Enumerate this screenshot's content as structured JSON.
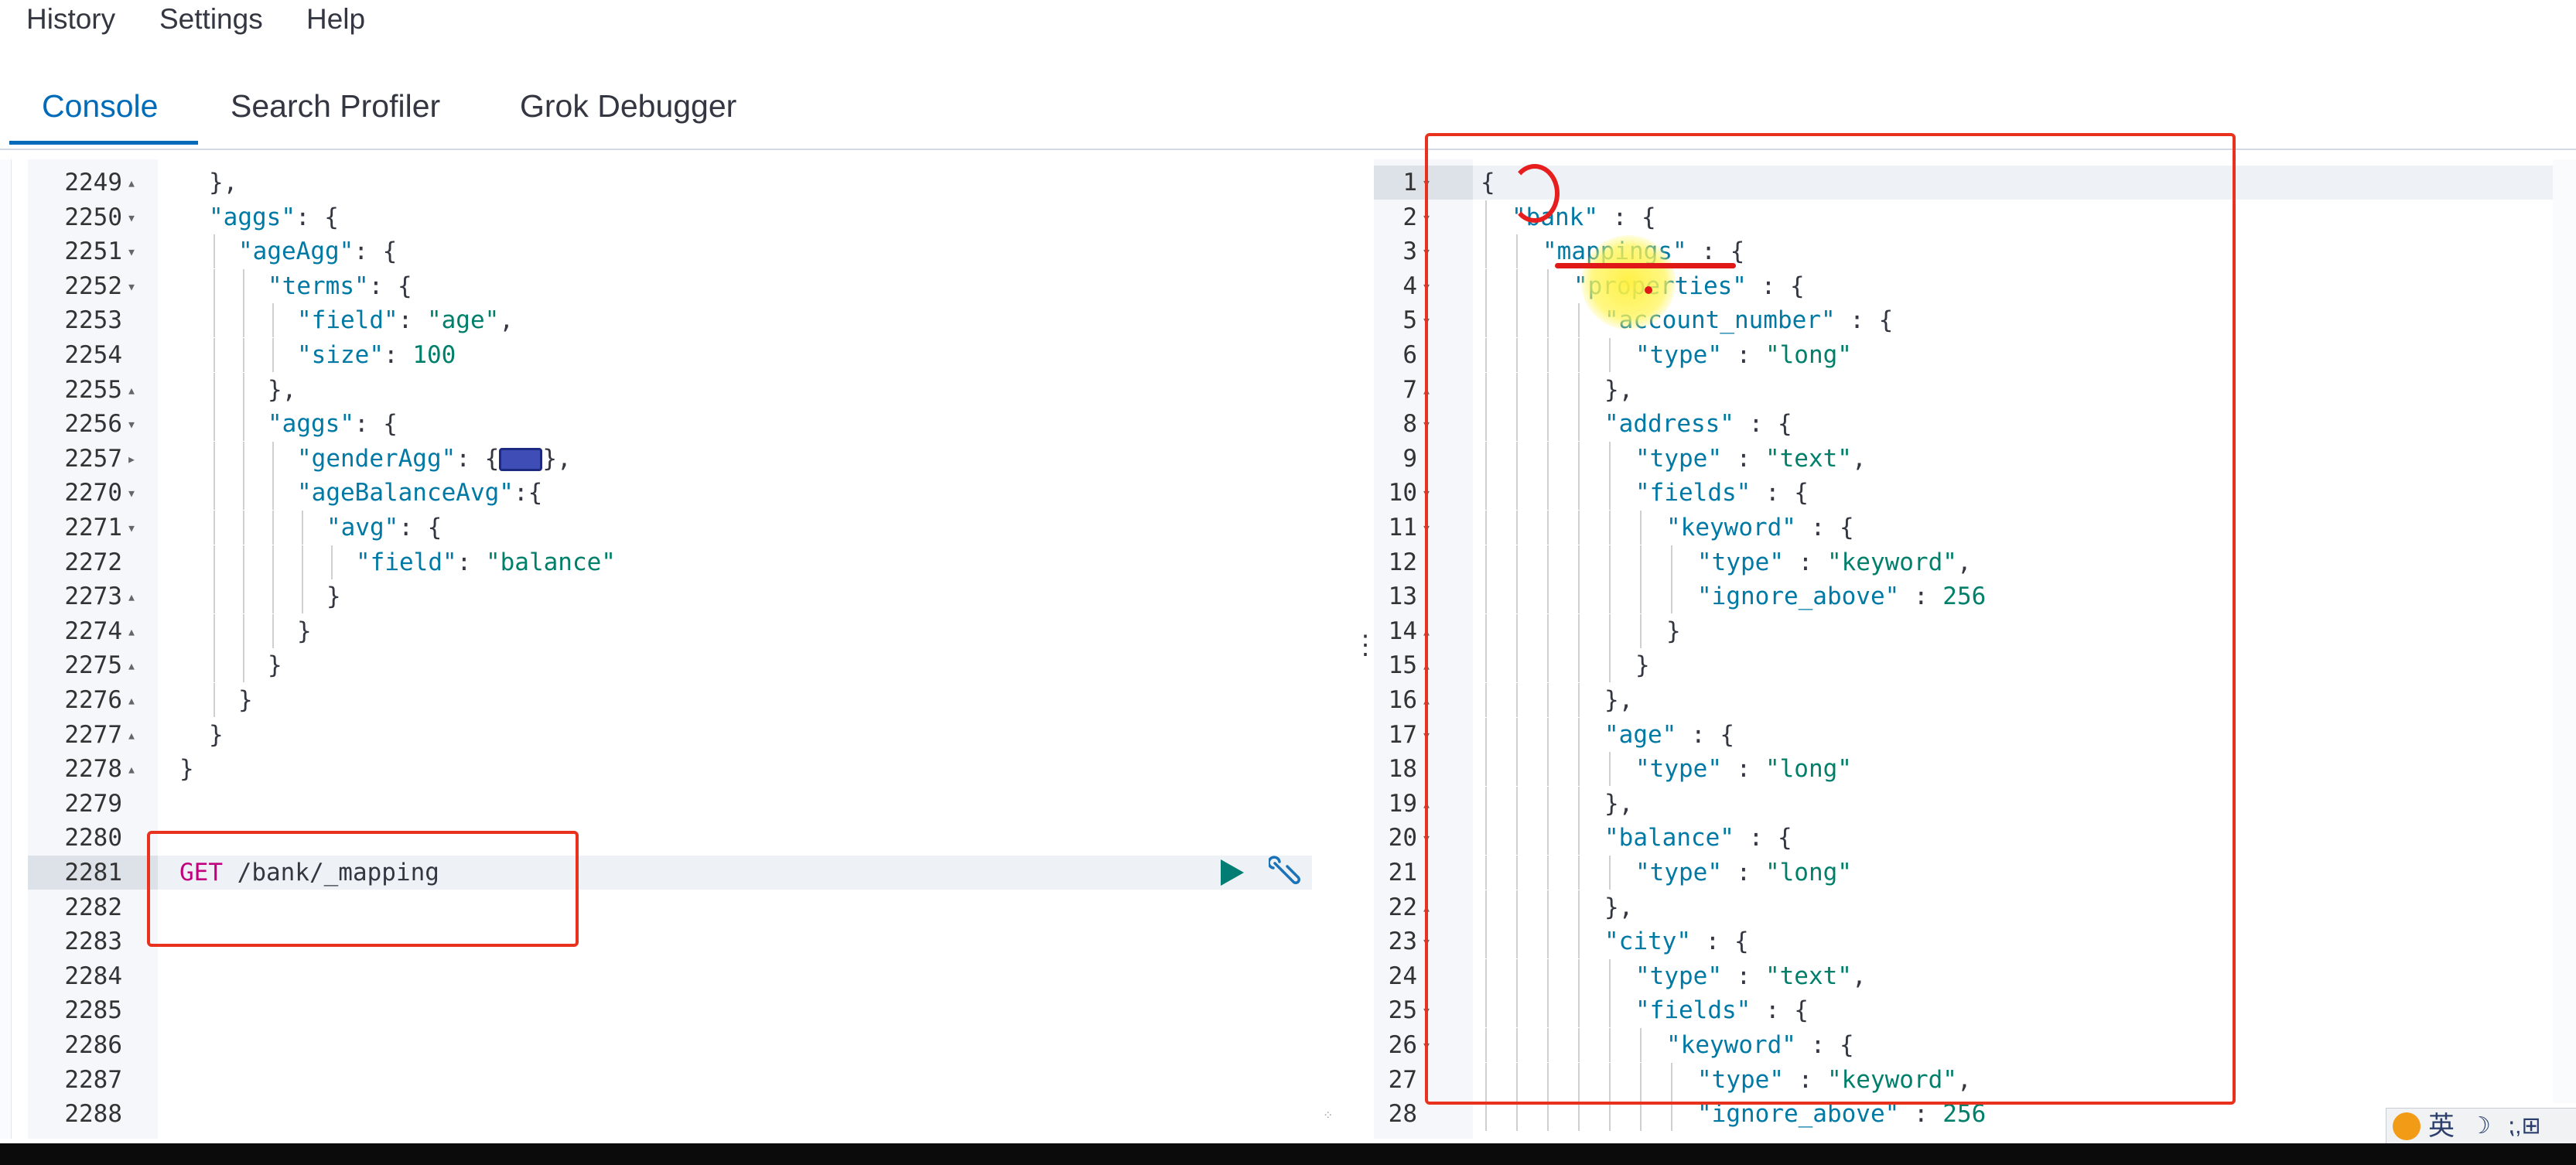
{
  "menu": {
    "history": "History",
    "settings": "Settings",
    "help": "Help"
  },
  "tabs": [
    {
      "label": "Console",
      "active": true
    },
    {
      "label": "Search Profiler",
      "active": false
    },
    {
      "label": "Grok Debugger",
      "active": false
    }
  ],
  "request_editor": {
    "active_line": "2281",
    "lines": [
      {
        "num": "2249",
        "fold": "▴",
        "indent": 1,
        "tokens": [
          [
            "p",
            "},"
          ]
        ]
      },
      {
        "num": "2250",
        "fold": "▾",
        "indent": 1,
        "tokens": [
          [
            "k",
            "\"aggs\""
          ],
          [
            "p",
            ": {"
          ]
        ]
      },
      {
        "num": "2251",
        "fold": "▾",
        "indent": 2,
        "tokens": [
          [
            "k",
            "\"ageAgg\""
          ],
          [
            "p",
            ": {"
          ]
        ]
      },
      {
        "num": "2252",
        "fold": "▾",
        "indent": 3,
        "tokens": [
          [
            "k",
            "\"terms\""
          ],
          [
            "p",
            ": {"
          ]
        ]
      },
      {
        "num": "2253",
        "fold": "",
        "indent": 4,
        "tokens": [
          [
            "k",
            "\"field\""
          ],
          [
            "p",
            ": "
          ],
          [
            "s",
            "\"age\""
          ],
          [
            "p",
            ","
          ]
        ]
      },
      {
        "num": "2254",
        "fold": "",
        "indent": 4,
        "tokens": [
          [
            "k",
            "\"size\""
          ],
          [
            "p",
            ": "
          ],
          [
            "n",
            "100"
          ]
        ]
      },
      {
        "num": "2255",
        "fold": "▴",
        "indent": 3,
        "tokens": [
          [
            "p",
            "},"
          ]
        ]
      },
      {
        "num": "2256",
        "fold": "▾",
        "indent": 3,
        "tokens": [
          [
            "k",
            "\"aggs\""
          ],
          [
            "p",
            ": {"
          ]
        ]
      },
      {
        "num": "2257",
        "fold": "▸",
        "indent": 4,
        "tokens": [
          [
            "k",
            "\"genderAgg\""
          ],
          [
            "p",
            ": {"
          ],
          [
            "c",
            "⟺"
          ],
          [
            "p",
            "},"
          ]
        ]
      },
      {
        "num": "2270",
        "fold": "▾",
        "indent": 4,
        "tokens": [
          [
            "k",
            "\"ageBalanceAvg\""
          ],
          [
            "p",
            ":{"
          ]
        ]
      },
      {
        "num": "2271",
        "fold": "▾",
        "indent": 5,
        "tokens": [
          [
            "k",
            "\"avg\""
          ],
          [
            "p",
            ": {"
          ]
        ]
      },
      {
        "num": "2272",
        "fold": "",
        "indent": 6,
        "tokens": [
          [
            "k",
            "\"field\""
          ],
          [
            "p",
            ": "
          ],
          [
            "s",
            "\"balance\""
          ]
        ]
      },
      {
        "num": "2273",
        "fold": "▴",
        "indent": 5,
        "tokens": [
          [
            "p",
            "}"
          ]
        ]
      },
      {
        "num": "2274",
        "fold": "▴",
        "indent": 4,
        "tokens": [
          [
            "p",
            "}"
          ]
        ]
      },
      {
        "num": "2275",
        "fold": "▴",
        "indent": 3,
        "tokens": [
          [
            "p",
            "}"
          ]
        ]
      },
      {
        "num": "2276",
        "fold": "▴",
        "indent": 2,
        "tokens": [
          [
            "p",
            "}"
          ]
        ]
      },
      {
        "num": "2277",
        "fold": "▴",
        "indent": 1,
        "tokens": [
          [
            "p",
            "}"
          ]
        ]
      },
      {
        "num": "2278",
        "fold": "▴",
        "indent": 0,
        "tokens": [
          [
            "p",
            "}"
          ]
        ]
      },
      {
        "num": "2279",
        "fold": "",
        "indent": 0,
        "tokens": []
      },
      {
        "num": "2280",
        "fold": "",
        "indent": 0,
        "tokens": []
      },
      {
        "num": "2281",
        "fold": "",
        "indent": 0,
        "tokens": [
          [
            "m",
            "GET"
          ],
          [
            "p",
            " /bank/_mapping"
          ]
        ]
      },
      {
        "num": "2282",
        "fold": "",
        "indent": 0,
        "tokens": []
      },
      {
        "num": "2283",
        "fold": "",
        "indent": 0,
        "tokens": []
      },
      {
        "num": "2284",
        "fold": "",
        "indent": 0,
        "tokens": []
      },
      {
        "num": "2285",
        "fold": "",
        "indent": 0,
        "tokens": []
      },
      {
        "num": "2286",
        "fold": "",
        "indent": 0,
        "tokens": []
      },
      {
        "num": "2287",
        "fold": "",
        "indent": 0,
        "tokens": []
      },
      {
        "num": "2288",
        "fold": "",
        "indent": 0,
        "tokens": []
      }
    ]
  },
  "response_editor": {
    "lines": [
      {
        "num": "1",
        "fold": "▾",
        "indent": 0,
        "tokens": [
          [
            "p",
            "{"
          ]
        ]
      },
      {
        "num": "2",
        "fold": "▾",
        "indent": 1,
        "tokens": [
          [
            "k",
            "\"bank\""
          ],
          [
            "p",
            " : {"
          ]
        ]
      },
      {
        "num": "3",
        "fold": "▾",
        "indent": 2,
        "tokens": [
          [
            "k",
            "\"mappings\""
          ],
          [
            "p",
            " : {"
          ]
        ]
      },
      {
        "num": "4",
        "fold": "▾",
        "indent": 3,
        "tokens": [
          [
            "k",
            "\"properties\""
          ],
          [
            "p",
            " : {"
          ]
        ]
      },
      {
        "num": "5",
        "fold": "▾",
        "indent": 4,
        "tokens": [
          [
            "k",
            "\"account_number\""
          ],
          [
            "p",
            " : {"
          ]
        ]
      },
      {
        "num": "6",
        "fold": "",
        "indent": 5,
        "tokens": [
          [
            "k",
            "\"type\""
          ],
          [
            "p",
            " : "
          ],
          [
            "s",
            "\"long\""
          ]
        ]
      },
      {
        "num": "7",
        "fold": "▴",
        "indent": 4,
        "tokens": [
          [
            "p",
            "},"
          ]
        ]
      },
      {
        "num": "8",
        "fold": "▾",
        "indent": 4,
        "tokens": [
          [
            "k",
            "\"address\""
          ],
          [
            "p",
            " : {"
          ]
        ]
      },
      {
        "num": "9",
        "fold": "",
        "indent": 5,
        "tokens": [
          [
            "k",
            "\"type\""
          ],
          [
            "p",
            " : "
          ],
          [
            "s",
            "\"text\""
          ],
          [
            "p",
            ","
          ]
        ]
      },
      {
        "num": "10",
        "fold": "▾",
        "indent": 5,
        "tokens": [
          [
            "k",
            "\"fields\""
          ],
          [
            "p",
            " : {"
          ]
        ]
      },
      {
        "num": "11",
        "fold": "▾",
        "indent": 6,
        "tokens": [
          [
            "k",
            "\"keyword\""
          ],
          [
            "p",
            " : {"
          ]
        ]
      },
      {
        "num": "12",
        "fold": "",
        "indent": 7,
        "tokens": [
          [
            "k",
            "\"type\""
          ],
          [
            "p",
            " : "
          ],
          [
            "s",
            "\"keyword\""
          ],
          [
            "p",
            ","
          ]
        ]
      },
      {
        "num": "13",
        "fold": "",
        "indent": 7,
        "tokens": [
          [
            "k",
            "\"ignore_above\""
          ],
          [
            "p",
            " : "
          ],
          [
            "n",
            "256"
          ]
        ]
      },
      {
        "num": "14",
        "fold": "▴",
        "indent": 6,
        "tokens": [
          [
            "p",
            "}"
          ]
        ]
      },
      {
        "num": "15",
        "fold": "▴",
        "indent": 5,
        "tokens": [
          [
            "p",
            "}"
          ]
        ]
      },
      {
        "num": "16",
        "fold": "▴",
        "indent": 4,
        "tokens": [
          [
            "p",
            "},"
          ]
        ]
      },
      {
        "num": "17",
        "fold": "▾",
        "indent": 4,
        "tokens": [
          [
            "k",
            "\"age\""
          ],
          [
            "p",
            " : {"
          ]
        ]
      },
      {
        "num": "18",
        "fold": "",
        "indent": 5,
        "tokens": [
          [
            "k",
            "\"type\""
          ],
          [
            "p",
            " : "
          ],
          [
            "s",
            "\"long\""
          ]
        ]
      },
      {
        "num": "19",
        "fold": "▴",
        "indent": 4,
        "tokens": [
          [
            "p",
            "},"
          ]
        ]
      },
      {
        "num": "20",
        "fold": "▾",
        "indent": 4,
        "tokens": [
          [
            "k",
            "\"balance\""
          ],
          [
            "p",
            " : {"
          ]
        ]
      },
      {
        "num": "21",
        "fold": "",
        "indent": 5,
        "tokens": [
          [
            "k",
            "\"type\""
          ],
          [
            "p",
            " : "
          ],
          [
            "s",
            "\"long\""
          ]
        ]
      },
      {
        "num": "22",
        "fold": "▴",
        "indent": 4,
        "tokens": [
          [
            "p",
            "},"
          ]
        ]
      },
      {
        "num": "23",
        "fold": "▾",
        "indent": 4,
        "tokens": [
          [
            "k",
            "\"city\""
          ],
          [
            "p",
            " : {"
          ]
        ]
      },
      {
        "num": "24",
        "fold": "",
        "indent": 5,
        "tokens": [
          [
            "k",
            "\"type\""
          ],
          [
            "p",
            " : "
          ],
          [
            "s",
            "\"text\""
          ],
          [
            "p",
            ","
          ]
        ]
      },
      {
        "num": "25",
        "fold": "▾",
        "indent": 5,
        "tokens": [
          [
            "k",
            "\"fields\""
          ],
          [
            "p",
            " : {"
          ]
        ]
      },
      {
        "num": "26",
        "fold": "▾",
        "indent": 6,
        "tokens": [
          [
            "k",
            "\"keyword\""
          ],
          [
            "p",
            " : {"
          ]
        ]
      },
      {
        "num": "27",
        "fold": "",
        "indent": 7,
        "tokens": [
          [
            "k",
            "\"type\""
          ],
          [
            "p",
            " : "
          ],
          [
            "s",
            "\"keyword\""
          ],
          [
            "p",
            ","
          ]
        ]
      },
      {
        "num": "28",
        "fold": "",
        "indent": 7,
        "tokens": [
          [
            "k",
            "\"ignore_above\""
          ],
          [
            "p",
            " : "
          ],
          [
            "n",
            "256"
          ]
        ]
      }
    ]
  },
  "ime": {
    "lang": "英",
    "extra": "⁏,⊞"
  },
  "icons": {
    "play": "play-icon",
    "wrench": "wrench-icon",
    "splitter": "drag-handle-icon",
    "collapsed": "collapsed-object-icon"
  },
  "colors": {
    "accent": "#006bb8",
    "annotation_red": "#e8321e",
    "highlight_yellow": "#ffee33"
  }
}
